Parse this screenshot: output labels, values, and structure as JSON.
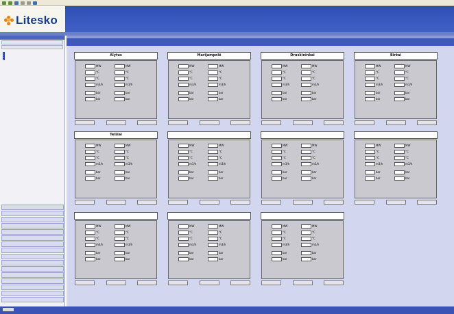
{
  "app": {
    "brand": "Litesko"
  },
  "colors": {
    "header": "#3a55bb",
    "brand_orange": "#e8861a",
    "brand_blue": "#1a3d8f",
    "panel_bg": "#c9c9cf",
    "main_bg": "#d2d6ee"
  },
  "sidebar": {
    "top_buttons": [
      "",
      ""
    ],
    "tree": [
      "",
      "",
      "",
      ""
    ],
    "nav": [
      "",
      "",
      "",
      "",
      "",
      "",
      "",
      "",
      "",
      "",
      "",
      "",
      "",
      "",
      "",
      ""
    ]
  },
  "panels": [
    {
      "title": "Alytus",
      "units": [
        "MW",
        "°C",
        "°C",
        "m3/h",
        "bar",
        "bar"
      ],
      "buttons": [
        "",
        "",
        ""
      ]
    },
    {
      "title": "Marijampolė",
      "units": [
        "MW",
        "°C",
        "°C",
        "m3/h",
        "bar",
        "bar"
      ],
      "buttons": [
        "",
        "",
        ""
      ]
    },
    {
      "title": "Druskininkai",
      "units": [
        "MW",
        "°C",
        "°C",
        "m3/h",
        "bar",
        "bar"
      ],
      "buttons": [
        "",
        "",
        ""
      ]
    },
    {
      "title": "Biržai",
      "units": [
        "MW",
        "°C",
        "°C",
        "m3/h",
        "bar",
        "bar"
      ],
      "buttons": [
        "",
        "",
        ""
      ]
    },
    {
      "title": "Telšiai",
      "units": [
        "MW",
        "°C",
        "°C",
        "m3/h",
        "bar",
        "bar"
      ],
      "buttons": [
        "",
        "",
        ""
      ]
    },
    {
      "title": "",
      "units": [
        "MW",
        "°C",
        "°C",
        "m3/h",
        "bar",
        "bar"
      ],
      "buttons": [
        "",
        "",
        ""
      ]
    },
    {
      "title": "",
      "units": [
        "MW",
        "°C",
        "°C",
        "m3/h",
        "bar",
        "bar"
      ],
      "buttons": [
        "",
        "",
        ""
      ]
    },
    {
      "title": "",
      "units": [
        "MW",
        "°C",
        "°C",
        "m3/h",
        "bar",
        "bar"
      ],
      "buttons": [
        "",
        "",
        ""
      ]
    },
    {
      "title": "",
      "units": [
        "MW",
        "°C",
        "°C",
        "m3/h",
        "bar",
        "bar"
      ],
      "buttons": [
        "",
        "",
        ""
      ]
    },
    {
      "title": "",
      "units": [
        "MW",
        "°C",
        "°C",
        "m3/h",
        "bar",
        "bar"
      ],
      "buttons": [
        "",
        "",
        ""
      ]
    },
    {
      "title": "",
      "units": [
        "MW",
        "°C",
        "°C",
        "m3/h",
        "bar",
        "bar"
      ],
      "buttons": [
        "",
        "",
        ""
      ]
    }
  ]
}
